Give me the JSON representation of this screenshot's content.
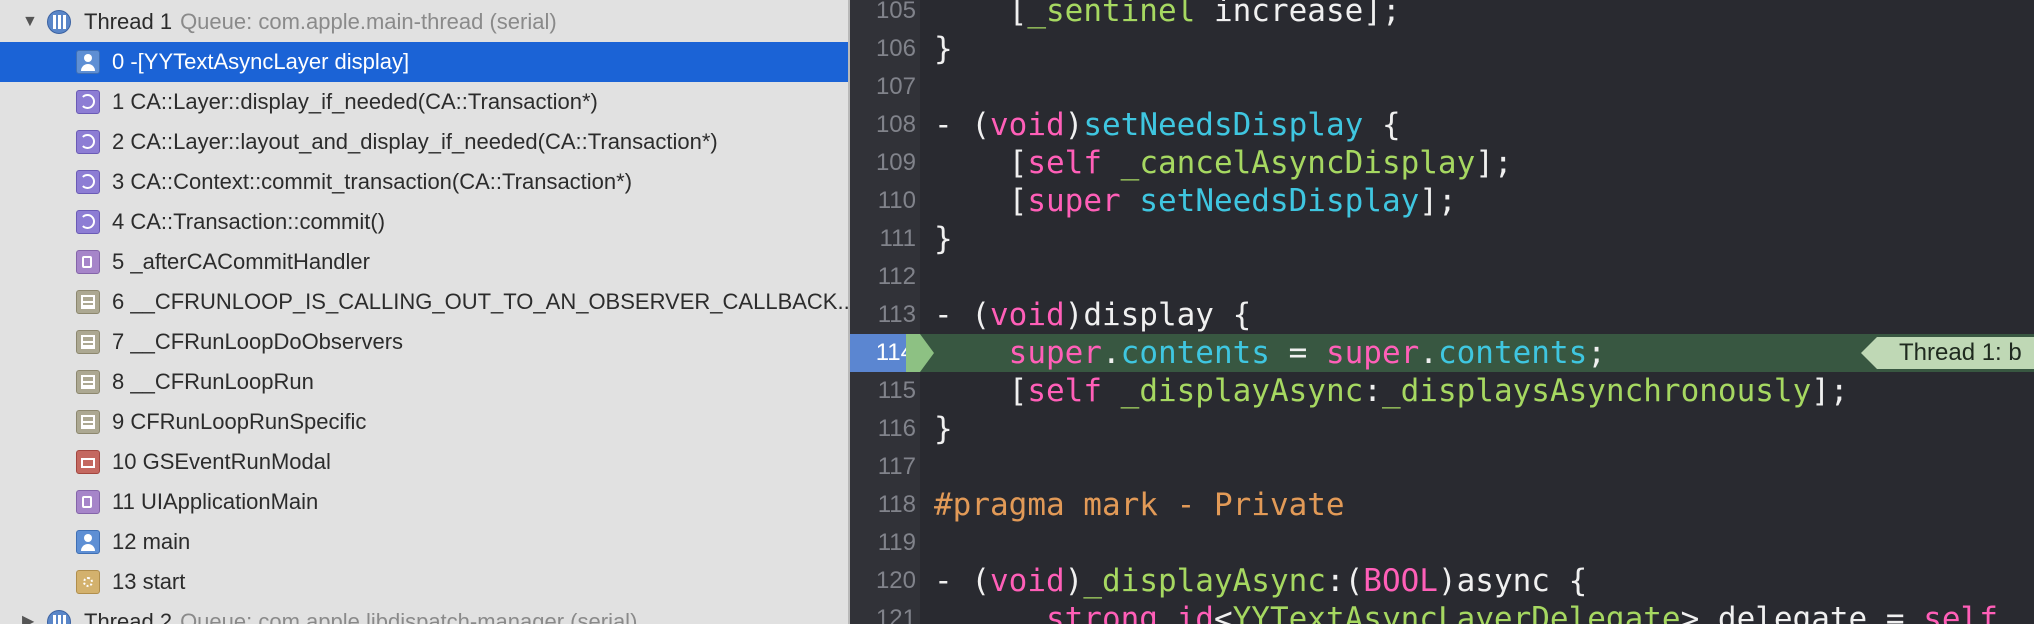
{
  "colors": {
    "selection": "#1b63d6",
    "navigator_bg": "#e1e1e1",
    "editor_bg": "#292a30",
    "keyword": "#ff5fb8",
    "method": "#3fc6e0",
    "identifier": "#a6d861",
    "preprocessor": "#e29a57",
    "current_line": "#385741"
  },
  "navigator": {
    "thread1": {
      "name": "Thread 1",
      "queue": "Queue: com.apple.main-thread (serial)"
    },
    "frames": [
      {
        "label": "0 -[YYTextAsyncLayer display]",
        "icon": "user-code-icon",
        "selected": true
      },
      {
        "label": "1 CA::Layer::display_if_needed(CA::Transaction*)",
        "icon": "core-animation-icon"
      },
      {
        "label": "2 CA::Layer::layout_and_display_if_needed(CA::Transaction*)",
        "icon": "core-animation-icon"
      },
      {
        "label": "3 CA::Context::commit_transaction(CA::Transaction*)",
        "icon": "core-animation-icon"
      },
      {
        "label": "4 CA::Transaction::commit()",
        "icon": "core-animation-icon"
      },
      {
        "label": "5 _afterCACommitHandler",
        "icon": "cup-icon"
      },
      {
        "label": "6 __CFRUNLOOP_IS_CALLING_OUT_TO_AN_OBSERVER_CALLBACK...",
        "icon": "core-foundation-icon"
      },
      {
        "label": "7 __CFRunLoopDoObservers",
        "icon": "core-foundation-icon"
      },
      {
        "label": "8 __CFRunLoopRun",
        "icon": "core-foundation-icon"
      },
      {
        "label": "9 CFRunLoopRunSpecific",
        "icon": "core-foundation-icon"
      },
      {
        "label": "10 GSEventRunModal",
        "icon": "briefcase-icon"
      },
      {
        "label": "11 UIApplicationMain",
        "icon": "cup-icon"
      },
      {
        "label": "12 main",
        "icon": "user-code-icon"
      },
      {
        "label": "13 start",
        "icon": "gear-icon"
      }
    ],
    "thread2": {
      "name": "Thread 2",
      "queue": "Queue: com.apple.libdispatch-manager (serial)"
    }
  },
  "editor": {
    "lines": [
      {
        "num": "105",
        "text": "    [_sentinel increase];"
      },
      {
        "num": "106",
        "text": "}"
      },
      {
        "num": "107",
        "text": ""
      },
      {
        "num": "108",
        "text": "- (void)setNeedsDisplay {"
      },
      {
        "num": "109",
        "text": "    [self _cancelAsyncDisplay];"
      },
      {
        "num": "110",
        "text": "    [super setNeedsDisplay];"
      },
      {
        "num": "111",
        "text": "}"
      },
      {
        "num": "112",
        "text": ""
      },
      {
        "num": "113",
        "text": "- (void)display {"
      },
      {
        "num": "114",
        "text": "    super.contents = super.contents;"
      },
      {
        "num": "115",
        "text": "    [self _displayAsync:_displaysAsynchronously];"
      },
      {
        "num": "116",
        "text": "}"
      },
      {
        "num": "117",
        "text": ""
      },
      {
        "num": "118",
        "text": "#pragma mark - Private"
      },
      {
        "num": "119",
        "text": ""
      },
      {
        "num": "120",
        "text": "- (void)_displayAsync:(BOOL)async {"
      },
      {
        "num": "121",
        "text": "    __strong id<YYTextAsyncLayerDelegate> delegate = self"
      }
    ],
    "current_line": "114",
    "breakpoint_badge": "Thread 1: b"
  }
}
